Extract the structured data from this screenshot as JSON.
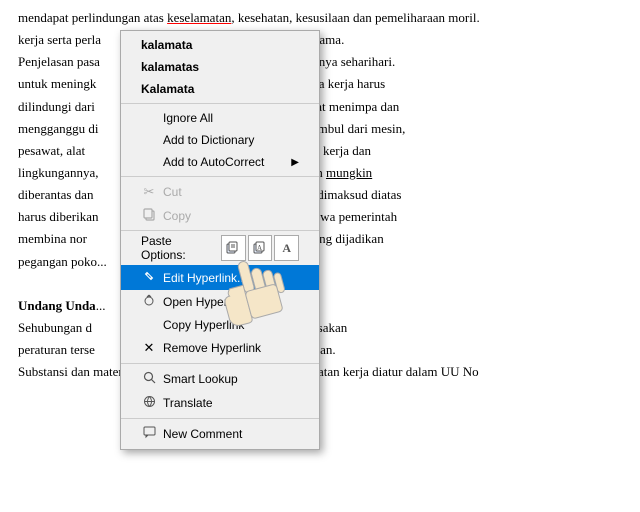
{
  "document": {
    "lines": [
      "mendapat perlindungan atas keselamatan, kesehatan, kesusilaan dan pemeliharaan moril.",
      "kerja serta perla                martabat manusia dan moral agama.",
      "Penjelasan pasa                 aya aman melakukan pekerjaannya seharihari.",
      "untuk meningk                  duktivitas nasional maka tenaga kerja harus",
      "dilindungi dari                    ra serta pada dirinya yang dapat menimpa dan",
      "mengganggu di                   riaannya. Bahaya yang dapat timbul dari mesin,",
      "pesawat, alat                   pengolahannya, keadaan tempat kerja dan",
      "lingkungannya,                  ukan pekerjaannya, harus sejauh mungkin",
      "diberantas dan                   ebab itu, hak atas perlindungan dimaksud diatas",
      "harus diberikan                 lam UU ini juga dinyatakan bahwa pemerintah",
      "membina nor                    kerja, sebagai standar ukuran yang dijadikan",
      "pegangan poko...",
      "",
      "Undang Unda...                  Keselamatan Kerja",
      "Sehubungan d                   terjadi dimasyarakat, maka dirasakan",
      "peraturan terse                   i dan perlu diadakan pembaharuan.",
      "Substansi dan materi teknis Norma nyperkes dan keselamatan kerja diatur dalam UU No"
    ],
    "highlighted_word": "keselamatan"
  },
  "context_menu": {
    "spell_suggestions": [
      {
        "label": "kalamata"
      },
      {
        "label": "kalamatas"
      },
      {
        "label": "Kalamata"
      }
    ],
    "items": [
      {
        "id": "ignore-all",
        "label": "Ignore All",
        "icon": "",
        "disabled": false
      },
      {
        "id": "add-to-dict",
        "label": "Add to Dictionary",
        "icon": "",
        "disabled": false
      },
      {
        "id": "add-to-autocorrect",
        "label": "Add to AutoCorrect",
        "icon": "",
        "has_arrow": true,
        "disabled": false
      },
      {
        "id": "cut",
        "label": "Cut",
        "icon": "✂",
        "disabled": true
      },
      {
        "id": "copy",
        "label": "Copy",
        "icon": "",
        "disabled": true
      },
      {
        "id": "paste-options-label",
        "label": "Paste Options:",
        "is_paste_section": true
      },
      {
        "id": "edit-hyperlink",
        "label": "Edit Hyperlink...",
        "icon": "🔗",
        "highlighted": true
      },
      {
        "id": "open-hyperlink",
        "label": "Open Hyperlink",
        "icon": "🌐",
        "disabled": false
      },
      {
        "id": "copy-hyperlink",
        "label": "Copy Hyperlink",
        "icon": "",
        "disabled": false
      },
      {
        "id": "remove-hyperlink",
        "label": "Remove Hyperlink",
        "icon": "✕",
        "disabled": false
      },
      {
        "id": "smart-lookup",
        "label": "Smart Lookup",
        "icon": "🔍",
        "disabled": false
      },
      {
        "id": "translate",
        "label": "Translate",
        "icon": "🌐",
        "disabled": false
      },
      {
        "id": "new-comment",
        "label": "New Comment",
        "icon": "💬",
        "disabled": false
      }
    ]
  }
}
